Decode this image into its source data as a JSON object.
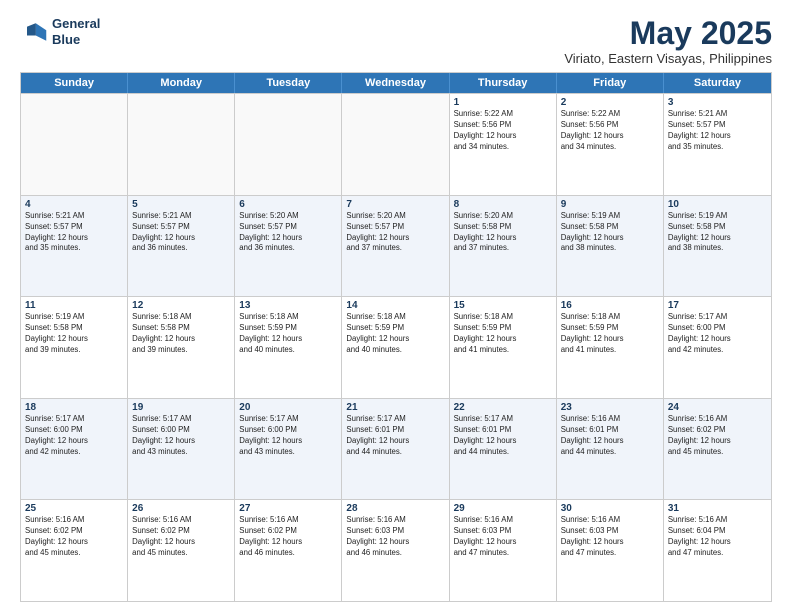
{
  "header": {
    "logo_line1": "General",
    "logo_line2": "Blue",
    "month": "May 2025",
    "location": "Viriato, Eastern Visayas, Philippines"
  },
  "days_of_week": [
    "Sunday",
    "Monday",
    "Tuesday",
    "Wednesday",
    "Thursday",
    "Friday",
    "Saturday"
  ],
  "rows": [
    [
      {
        "day": "",
        "text": "",
        "empty": true
      },
      {
        "day": "",
        "text": "",
        "empty": true
      },
      {
        "day": "",
        "text": "",
        "empty": true
      },
      {
        "day": "",
        "text": "",
        "empty": true
      },
      {
        "day": "1",
        "text": "Sunrise: 5:22 AM\nSunset: 5:56 PM\nDaylight: 12 hours\nand 34 minutes.",
        "empty": false
      },
      {
        "day": "2",
        "text": "Sunrise: 5:22 AM\nSunset: 5:56 PM\nDaylight: 12 hours\nand 34 minutes.",
        "empty": false
      },
      {
        "day": "3",
        "text": "Sunrise: 5:21 AM\nSunset: 5:57 PM\nDaylight: 12 hours\nand 35 minutes.",
        "empty": false
      }
    ],
    [
      {
        "day": "4",
        "text": "Sunrise: 5:21 AM\nSunset: 5:57 PM\nDaylight: 12 hours\nand 35 minutes.",
        "empty": false
      },
      {
        "day": "5",
        "text": "Sunrise: 5:21 AM\nSunset: 5:57 PM\nDaylight: 12 hours\nand 36 minutes.",
        "empty": false
      },
      {
        "day": "6",
        "text": "Sunrise: 5:20 AM\nSunset: 5:57 PM\nDaylight: 12 hours\nand 36 minutes.",
        "empty": false
      },
      {
        "day": "7",
        "text": "Sunrise: 5:20 AM\nSunset: 5:57 PM\nDaylight: 12 hours\nand 37 minutes.",
        "empty": false
      },
      {
        "day": "8",
        "text": "Sunrise: 5:20 AM\nSunset: 5:58 PM\nDaylight: 12 hours\nand 37 minutes.",
        "empty": false
      },
      {
        "day": "9",
        "text": "Sunrise: 5:19 AM\nSunset: 5:58 PM\nDaylight: 12 hours\nand 38 minutes.",
        "empty": false
      },
      {
        "day": "10",
        "text": "Sunrise: 5:19 AM\nSunset: 5:58 PM\nDaylight: 12 hours\nand 38 minutes.",
        "empty": false
      }
    ],
    [
      {
        "day": "11",
        "text": "Sunrise: 5:19 AM\nSunset: 5:58 PM\nDaylight: 12 hours\nand 39 minutes.",
        "empty": false
      },
      {
        "day": "12",
        "text": "Sunrise: 5:18 AM\nSunset: 5:58 PM\nDaylight: 12 hours\nand 39 minutes.",
        "empty": false
      },
      {
        "day": "13",
        "text": "Sunrise: 5:18 AM\nSunset: 5:59 PM\nDaylight: 12 hours\nand 40 minutes.",
        "empty": false
      },
      {
        "day": "14",
        "text": "Sunrise: 5:18 AM\nSunset: 5:59 PM\nDaylight: 12 hours\nand 40 minutes.",
        "empty": false
      },
      {
        "day": "15",
        "text": "Sunrise: 5:18 AM\nSunset: 5:59 PM\nDaylight: 12 hours\nand 41 minutes.",
        "empty": false
      },
      {
        "day": "16",
        "text": "Sunrise: 5:18 AM\nSunset: 5:59 PM\nDaylight: 12 hours\nand 41 minutes.",
        "empty": false
      },
      {
        "day": "17",
        "text": "Sunrise: 5:17 AM\nSunset: 6:00 PM\nDaylight: 12 hours\nand 42 minutes.",
        "empty": false
      }
    ],
    [
      {
        "day": "18",
        "text": "Sunrise: 5:17 AM\nSunset: 6:00 PM\nDaylight: 12 hours\nand 42 minutes.",
        "empty": false
      },
      {
        "day": "19",
        "text": "Sunrise: 5:17 AM\nSunset: 6:00 PM\nDaylight: 12 hours\nand 43 minutes.",
        "empty": false
      },
      {
        "day": "20",
        "text": "Sunrise: 5:17 AM\nSunset: 6:00 PM\nDaylight: 12 hours\nand 43 minutes.",
        "empty": false
      },
      {
        "day": "21",
        "text": "Sunrise: 5:17 AM\nSunset: 6:01 PM\nDaylight: 12 hours\nand 44 minutes.",
        "empty": false
      },
      {
        "day": "22",
        "text": "Sunrise: 5:17 AM\nSunset: 6:01 PM\nDaylight: 12 hours\nand 44 minutes.",
        "empty": false
      },
      {
        "day": "23",
        "text": "Sunrise: 5:16 AM\nSunset: 6:01 PM\nDaylight: 12 hours\nand 44 minutes.",
        "empty": false
      },
      {
        "day": "24",
        "text": "Sunrise: 5:16 AM\nSunset: 6:02 PM\nDaylight: 12 hours\nand 45 minutes.",
        "empty": false
      }
    ],
    [
      {
        "day": "25",
        "text": "Sunrise: 5:16 AM\nSunset: 6:02 PM\nDaylight: 12 hours\nand 45 minutes.",
        "empty": false
      },
      {
        "day": "26",
        "text": "Sunrise: 5:16 AM\nSunset: 6:02 PM\nDaylight: 12 hours\nand 45 minutes.",
        "empty": false
      },
      {
        "day": "27",
        "text": "Sunrise: 5:16 AM\nSunset: 6:02 PM\nDaylight: 12 hours\nand 46 minutes.",
        "empty": false
      },
      {
        "day": "28",
        "text": "Sunrise: 5:16 AM\nSunset: 6:03 PM\nDaylight: 12 hours\nand 46 minutes.",
        "empty": false
      },
      {
        "day": "29",
        "text": "Sunrise: 5:16 AM\nSunset: 6:03 PM\nDaylight: 12 hours\nand 47 minutes.",
        "empty": false
      },
      {
        "day": "30",
        "text": "Sunrise: 5:16 AM\nSunset: 6:03 PM\nDaylight: 12 hours\nand 47 minutes.",
        "empty": false
      },
      {
        "day": "31",
        "text": "Sunrise: 5:16 AM\nSunset: 6:04 PM\nDaylight: 12 hours\nand 47 minutes.",
        "empty": false
      }
    ]
  ]
}
